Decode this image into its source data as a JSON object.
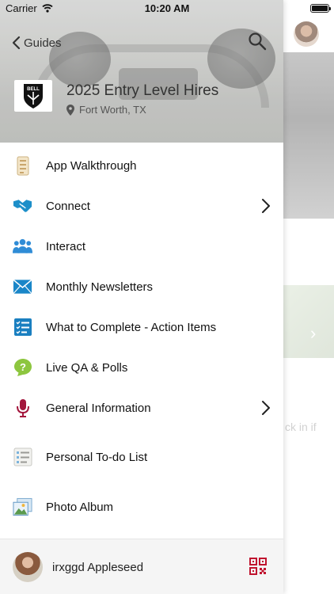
{
  "status_bar": {
    "carrier": "Carrier",
    "time": "10:20 AM"
  },
  "header": {
    "back_label": "Guides",
    "logo_text": "BELL",
    "title": "2025 Entry Level Hires",
    "location": "Fort Worth, TX"
  },
  "menu": {
    "items": [
      {
        "label": "App Walkthrough",
        "icon": "walkthrough-icon",
        "has_chevron": false
      },
      {
        "label": "Connect",
        "icon": "handshake-icon",
        "has_chevron": true
      },
      {
        "label": "Interact",
        "icon": "people-icon",
        "has_chevron": false
      },
      {
        "label": "Monthly Newsletters",
        "icon": "envelope-icon",
        "has_chevron": false
      },
      {
        "label": "What to Complete - Action Items",
        "icon": "checklist-icon",
        "has_chevron": false
      },
      {
        "label": "Live QA & Polls",
        "icon": "question-icon",
        "has_chevron": false
      },
      {
        "label": "General Information",
        "icon": "microphone-icon",
        "has_chevron": true
      },
      {
        "label": "Personal To-do List",
        "icon": "todo-list-icon",
        "has_chevron": false
      },
      {
        "label": "Photo Album",
        "icon": "photo-icon",
        "has_chevron": false
      }
    ]
  },
  "footer": {
    "user_name": "irxggd Appleseed"
  },
  "background": {
    "partial_text": "ck in if"
  },
  "colors": {
    "handshake": "#1d8fc9",
    "people": "#2f8cd6",
    "envelope": "#1a86c8",
    "checklist": "#1a7fc0",
    "question": "#8dc63f",
    "microphone": "#a3163c",
    "qr": "#c0142f"
  }
}
